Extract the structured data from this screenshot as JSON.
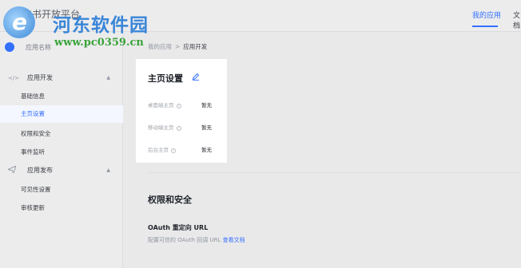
{
  "header": {
    "brand": "飞书开放平台",
    "tabs": [
      {
        "label": "我的应用",
        "active": true
      },
      {
        "label": "文档",
        "active": false
      }
    ]
  },
  "watermark": {
    "title": "河东软件园",
    "url": "www.pc0359.cn"
  },
  "sidebar": {
    "app_name": "应用名称",
    "groups": [
      {
        "label": "应用开发",
        "icon": "code-icon",
        "items": [
          {
            "label": "基础信息",
            "active": false
          },
          {
            "label": "主页设置",
            "active": true
          },
          {
            "label": "权限和安全",
            "active": false
          },
          {
            "label": "事件监听",
            "active": false
          }
        ]
      },
      {
        "label": "应用发布",
        "icon": "send-icon",
        "items": [
          {
            "label": "可见性设置",
            "active": false
          },
          {
            "label": "审核更新",
            "active": false
          }
        ]
      }
    ]
  },
  "breadcrumb": {
    "root": "我的应用",
    "separator": ">",
    "current": "应用开发"
  },
  "homepage_card": {
    "title": "主页设置",
    "rows": [
      {
        "label": "桌面端主页",
        "value": "暂无"
      },
      {
        "label": "移动端主页",
        "value": "暂无"
      },
      {
        "label": "后台主页",
        "value": "暂无"
      }
    ]
  },
  "security": {
    "title": "权限和安全",
    "oauth_title": "OAuth 重定向 URL",
    "oauth_desc": "配置可信的 OAuth 回调 URL",
    "oauth_link": "查看文档"
  },
  "colors": {
    "accent": "#3370ff"
  }
}
